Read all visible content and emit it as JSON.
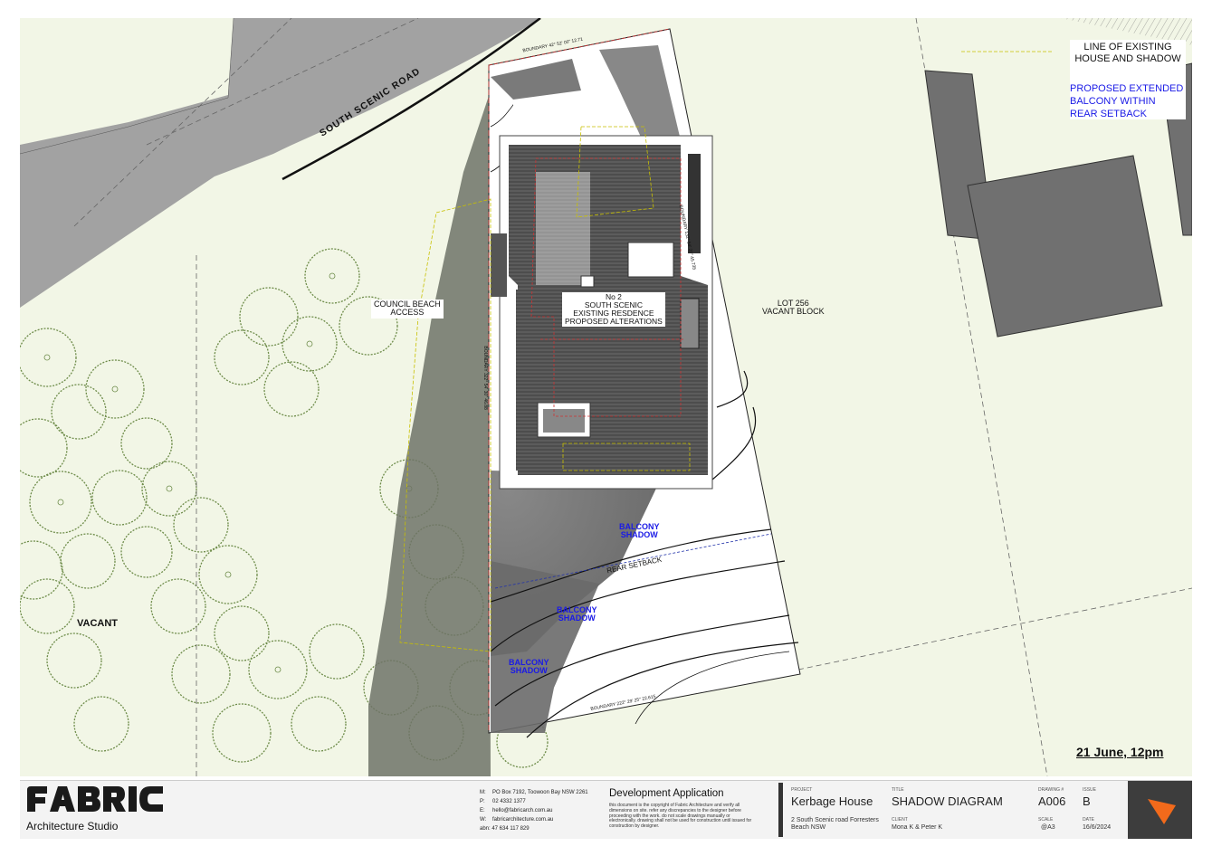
{
  "drawing": {
    "road_label": "SOUTH SCENIC ROAD",
    "council_access": "COUNCIL BEACH\nACCESS",
    "house_label": "No 2\nSOUTH SCENIC\nEXISTING RESDENCE\nPROPOSED ALTERATIONS",
    "lot_label": "LOT 256\nVACANT BLOCK",
    "vacant_label": "VACANT",
    "balcony_shadow_1": "BALCONY\nSHADOW",
    "balcony_shadow_2": "BALCONY\nSHADOW",
    "balcony_shadow_3": "BALCONY\nSHADOW",
    "rear_setback": "REAR SETBACK",
    "boundary_top": "BOUNDARY 42° 52' 00\" 12.71",
    "boundary_left": "BOUNDARY 322° 54' 30\" 46.88",
    "boundary_right": "BOUNDARY 132° 54' 20\" 45.735",
    "boundary_bottom": "BOUNDARY 222° 29' 25\" 22.615",
    "date_label": "21 June, 12pm",
    "colors": {
      "ground": "#f2f6e6",
      "road": "#a2a2a2",
      "shadow": "#6f7367",
      "roof": "#5a5a5a",
      "tree": "#6e8c4a",
      "accent_blue": "#1a1ae6",
      "brand_orange": "#f26a1b"
    }
  },
  "legend": {
    "existing": "LINE OF EXISTING\nHOUSE AND SHADOW",
    "proposed": "PROPOSED EXTENDED\nBALCONY WITHIN\nREAR SETBACK"
  },
  "title_block": {
    "studio": "Architecture Studio",
    "contact_m_label": "M:",
    "contact_m": "PO Box 7192, Toowoon Bay NSW 2261",
    "contact_p_label": "P:",
    "contact_p": "02 4332 1377",
    "contact_e_label": "E:",
    "contact_e": "hello@fabricarch.com.au",
    "contact_w_label": "W:",
    "contact_w": "fabricarchitecture.com.au",
    "abn": "abn: 47 634 117 829",
    "da_title": "Development Application",
    "da_note": "this document is the copyright of Fabric Architecture and verify all dimensions on site. refer any discrepancies to the designer before proceeding with the work. do not scale drawings manually or electronically. drawing shall not be used for construction until issued for construction by designer.",
    "project_label": "PROJECT",
    "project": "Kerbage House",
    "address": "2 South Scenic road Forresters\nBeach NSW",
    "title_label": "TITLE",
    "title": "SHADOW DIAGRAM",
    "client_label": "CLIENT",
    "client": "Mona K & Peter K",
    "drawing_no_label": "DRAWING #",
    "drawing_no": "A006",
    "issue_label": "ISSUE",
    "issue": "B",
    "scale_label": "SCALE",
    "scale": "@A3",
    "date_field_label": "DATE",
    "date": "16/6/2024"
  }
}
